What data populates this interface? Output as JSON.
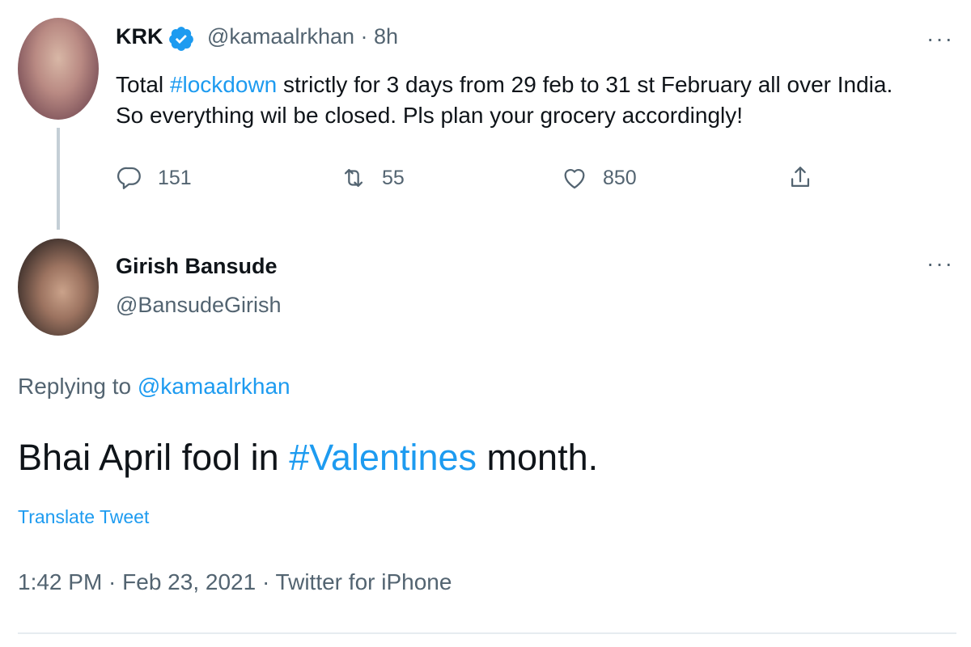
{
  "original_tweet": {
    "author_name": "KRK",
    "handle": "@kamaalrkhan",
    "time": "· 8h",
    "text_before": "Total ",
    "hashtag": "#lockdown",
    "text_after": " strictly for 3 days from 29 feb to 31 st February all over India. So everything wil be closed. Pls plan your grocery accordingly!",
    "more": "···",
    "actions": {
      "replies": "151",
      "retweets": "55",
      "likes": "850"
    }
  },
  "reply_tweet": {
    "author_name": "Girish Bansude",
    "handle": "@BansudeGirish",
    "more": "···",
    "replying_label": "Replying to ",
    "replying_handle": "@kamaalrkhan",
    "text_before": "Bhai April fool in ",
    "hashtag": "#Valentines",
    "text_after": " month.",
    "translate_label": "Translate Tweet",
    "timestamp": "1:42 PM · Feb 23, 2021 · Twitter for iPhone"
  },
  "colors": {
    "link": "#1d9bf0",
    "secondary_text": "#536471",
    "primary_text": "#0f1419"
  }
}
